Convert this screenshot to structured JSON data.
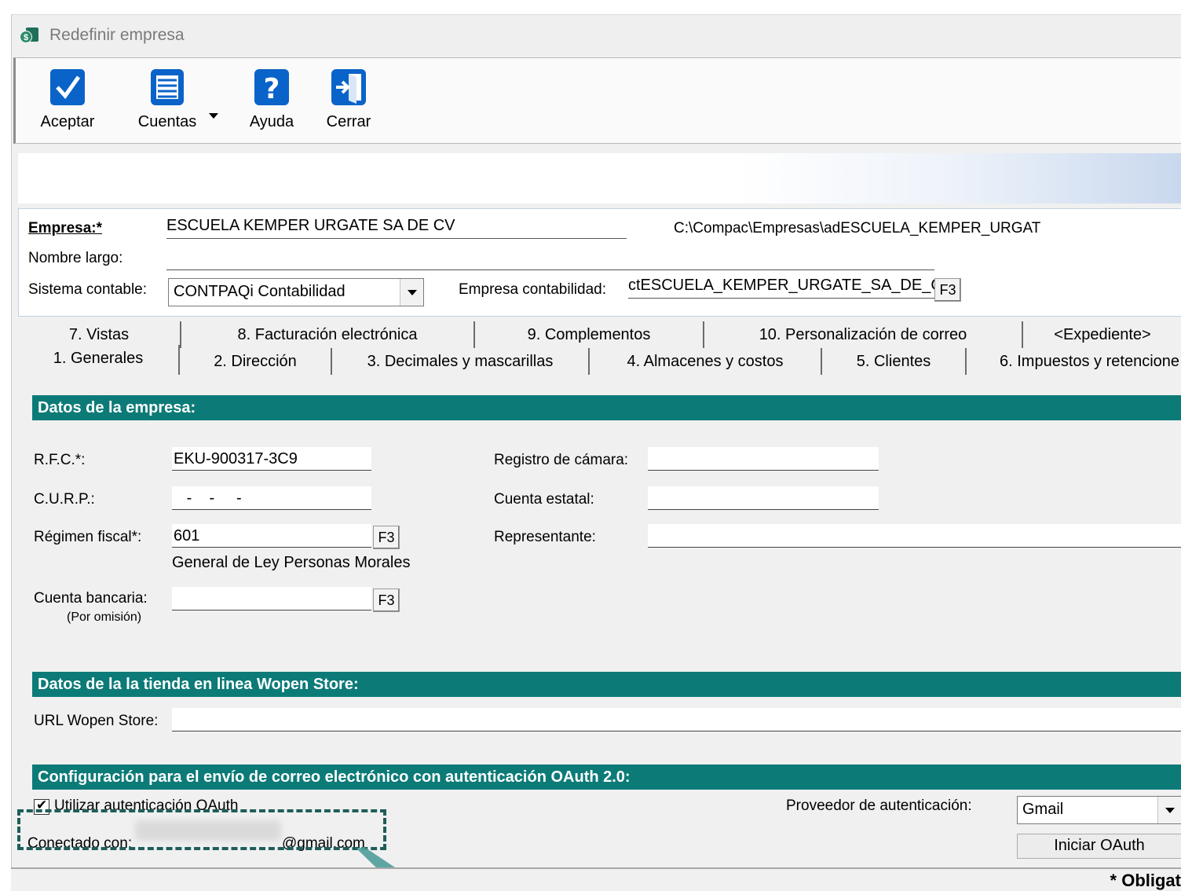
{
  "window": {
    "title": "Redefinir empresa",
    "app_icon_letter": "$"
  },
  "toolbar": {
    "accept_label": "Aceptar",
    "accounts_label": "Cuentas",
    "help_label": "Ayuda",
    "close_label": "Cerrar"
  },
  "company": {
    "empresa_label": "Empresa:*",
    "empresa_value": "ESCUELA KEMPER URGATE SA DE CV",
    "path": "C:\\Compac\\Empresas\\adESCUELA_KEMPER_URGAT",
    "nombre_largo_label": "Nombre largo:",
    "nombre_largo_value": "",
    "sistema_label": "Sistema contable:",
    "sistema_value": "CONTPAQi Contabilidad",
    "empresa_contab_label": "Empresa contabilidad:",
    "empresa_contab_value": "ctESCUELA_KEMPER_URGATE_SA_DE_C",
    "f3": "F3"
  },
  "tabs_top": [
    "7. Vistas",
    "8. Facturación electrónica",
    "9. Complementos",
    "10. Personalización de correo",
    "<Expediente>"
  ],
  "tabs_bottom": [
    "1. Generales",
    "2. Dirección",
    "3. Decimales y mascarillas",
    "4. Almacenes y costos",
    "5. Clientes",
    "6. Impuestos y retencione"
  ],
  "datos": {
    "header": "Datos de la empresa:",
    "rfc_label": "R.F.C.*:",
    "rfc_value": "EKU-900317-3C9",
    "curp_label": "C.U.R.P.:",
    "curp_value": "   -    -     -",
    "regimen_label": "Régimen fiscal*:",
    "regimen_value": "601",
    "regimen_desc": "General de Ley Personas Morales",
    "cuenta_bancaria_label": "Cuenta bancaria:",
    "cuenta_bancaria_note": "(Por omisión)",
    "registro_camara_label": "Registro de cámara:",
    "cuenta_estatal_label": "Cuenta estatal:",
    "representante_label": "Representante:"
  },
  "wopen": {
    "header": "Datos de la la tienda en linea Wopen Store:",
    "url_label": "URL Wopen Store:"
  },
  "oauth": {
    "header": "Configuración para el envío de correo electrónico con autenticación OAuth 2.0:",
    "use_label": "Utilizar autenticación OAuth",
    "provider_label": "Proveedor de autenticación:",
    "provider_value": "Gmail",
    "start_button": "Iniciar OAuth",
    "connected_prefix": "Conectado con:",
    "connected_suffix": "@gmail.com"
  },
  "status": {
    "required_note": "* Obligat"
  },
  "colors": {
    "section_header": "#0c7b78",
    "accent_icon": "#0a63c9",
    "callout": "#1e5e5a"
  }
}
